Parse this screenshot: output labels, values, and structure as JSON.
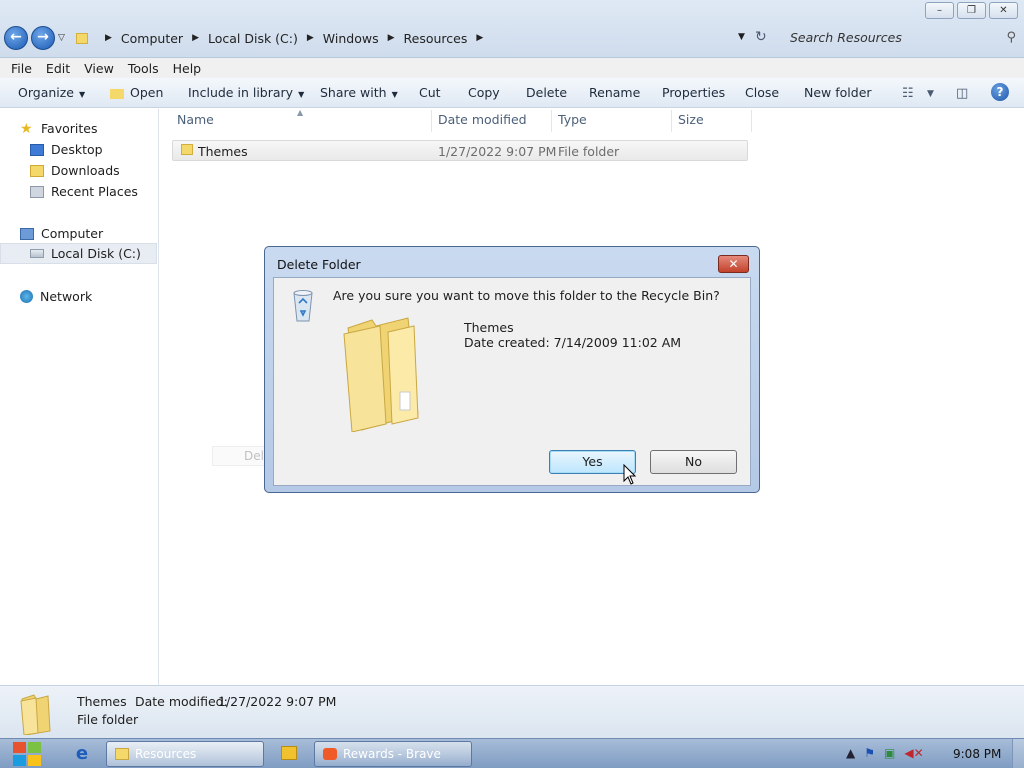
{
  "window": {
    "minimize": "–",
    "maximize": "❐",
    "close": "✕"
  },
  "address": {
    "back": "←",
    "forward": "→",
    "breadcrumbs": [
      "Computer",
      "Local Disk (C:)",
      "Windows",
      "Resources"
    ],
    "search_placeholder": "Search Resources"
  },
  "menu": [
    "File",
    "Edit",
    "View",
    "Tools",
    "Help"
  ],
  "commands": {
    "organize": "Organize",
    "open": "Open",
    "include_in_library": "Include in library",
    "share_with": "Share with",
    "cut": "Cut",
    "copy": "Copy",
    "delete": "Delete",
    "rename": "Rename",
    "properties": "Properties",
    "close": "Close",
    "new_folder": "New folder"
  },
  "nav": {
    "favorites": "Favorites",
    "desktop": "Desktop",
    "downloads": "Downloads",
    "recent_places": "Recent Places",
    "computer": "Computer",
    "local_disk": "Local Disk (C:)",
    "network": "Network"
  },
  "columns": {
    "name": "Name",
    "date_modified": "Date modified",
    "type": "Type",
    "size": "Size"
  },
  "files": [
    {
      "name": "Themes",
      "date_modified": "1/27/2022 9:07 PM",
      "type": "File folder",
      "size": ""
    }
  ],
  "ghost_text": "Delete",
  "dialog": {
    "title": "Delete Folder",
    "question": "Are you sure you want to move this folder to the Recycle Bin?",
    "item_name": "Themes",
    "item_date": "Date created: 7/14/2009 11:02 AM",
    "yes": "Yes",
    "no": "No",
    "close": "✕"
  },
  "details": {
    "name": "Themes",
    "modified_label": "Date modified:",
    "modified_value": "1/27/2022 9:07 PM",
    "type": "File folder"
  },
  "taskbar": {
    "explorer_label": "Resources",
    "brave_label": "Rewards - Brave",
    "clock": "9:08 PM"
  }
}
